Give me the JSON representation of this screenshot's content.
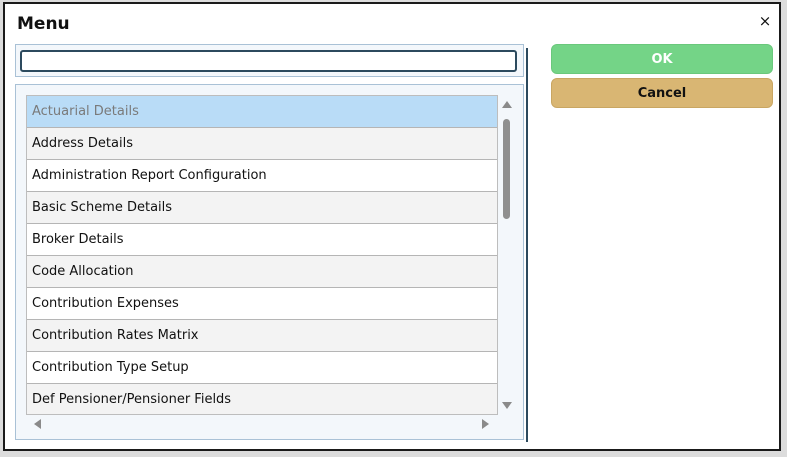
{
  "dialog": {
    "title": "Menu",
    "close_glyph": "×",
    "close_icon": "close-icon"
  },
  "search": {
    "value": "",
    "placeholder": ""
  },
  "list": {
    "selected_index": 0,
    "items": [
      {
        "label": "Actuarial Details"
      },
      {
        "label": "Address Details"
      },
      {
        "label": "Administration Report Configuration"
      },
      {
        "label": "Basic Scheme Details"
      },
      {
        "label": "Broker Details"
      },
      {
        "label": "Code Allocation"
      },
      {
        "label": "Contribution Expenses"
      },
      {
        "label": "Contribution Rates Matrix"
      },
      {
        "label": "Contribution Type Setup"
      },
      {
        "label": "Def Pensioner/Pensioner Fields"
      }
    ]
  },
  "buttons": {
    "ok_label": "OK",
    "cancel_label": "Cancel"
  },
  "colors": {
    "ok": "#74d487",
    "cancel": "#d9b673",
    "selected_row": "#b9dcf7"
  }
}
